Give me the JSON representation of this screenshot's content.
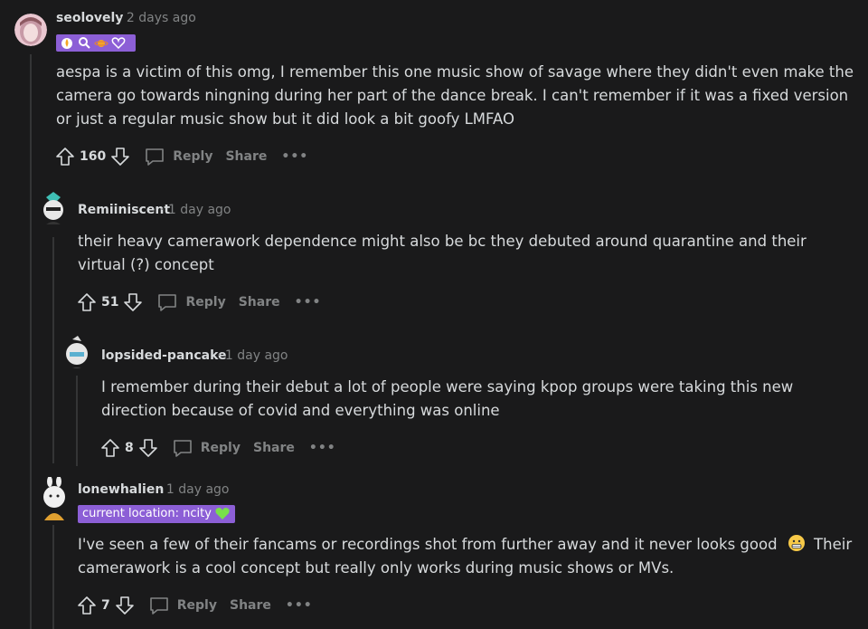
{
  "comments": [
    {
      "username": "seolovely",
      "time": "· 2 days ago",
      "flair_icons": [
        "fire-emoji",
        "magnifier-emoji",
        "planet-emoji",
        "heart-emoji"
      ],
      "body": "aespa is a victim of this omg, I remember this one music show of savage where they didn't even make the camera go towards ningning during her part of the dance break. I can't remember if it was a fixed version or just a regular music show but it did look a bit goofy LMFAO",
      "score": "160",
      "reply": "Reply",
      "share": "Share",
      "more": "•••"
    },
    {
      "username": "Remiiniscent",
      "time": "· 1 day ago",
      "body": "their heavy camerawork dependence might also be bc they debuted around quarantine and their virtual (?) concept",
      "score": "51",
      "reply": "Reply",
      "share": "Share",
      "more": "•••"
    },
    {
      "username": "lopsided-pancake",
      "time": "· 1 day ago",
      "body": "I remember during their debut a lot of people were saying kpop groups were taking this new direction because of covid and everything was online",
      "score": "8",
      "reply": "Reply",
      "share": "Share",
      "more": "•••"
    },
    {
      "username": "lonewhalien",
      "time": "· 1 day ago",
      "flair": "current location: ncity",
      "flair_icon": "green-heart-emoji",
      "body": "I've seen a few of their fancams or recordings shot from further away and it never looks good",
      "body_emoji": "grimacing-face-emoji",
      "body_after": " Their camerawork is a cool concept but really only works during music shows or MVs.",
      "score": "7",
      "reply": "Reply",
      "share": "Share",
      "more": "•••"
    }
  ],
  "colors": {
    "background": "#1a1a1b",
    "text": "#d7dadc",
    "muted": "#818384",
    "flair": "#8c5fd6",
    "thread_line": "#343536"
  }
}
